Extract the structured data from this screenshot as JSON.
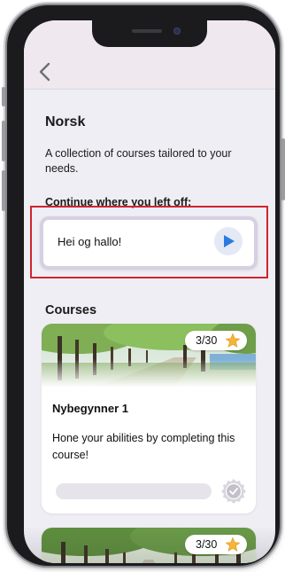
{
  "app": {
    "back_icon": "chevron-left-icon"
  },
  "page": {
    "title": "Norsk",
    "subtitle": "A collection of courses tailored to your needs.",
    "continue_label": "Continue where you left off:"
  },
  "resume": {
    "title": "Hei og hallo!",
    "play_icon": "play-icon"
  },
  "courses": {
    "label": "Courses",
    "items": [
      {
        "name": "Nybegynner 1",
        "description": "Hone your abilities by completing this course!",
        "progress_text": "3/30",
        "progress_fraction": 0,
        "star_icon": "star-icon",
        "medal_icon": "check-medal-icon"
      },
      {
        "progress_text": "3/30",
        "star_icon": "star-icon"
      }
    ]
  },
  "colors": {
    "accent_blue": "#2d7be0",
    "highlight_red": "#d0242f",
    "star_gold": "#f4b63a",
    "background": "#f0eef5"
  }
}
